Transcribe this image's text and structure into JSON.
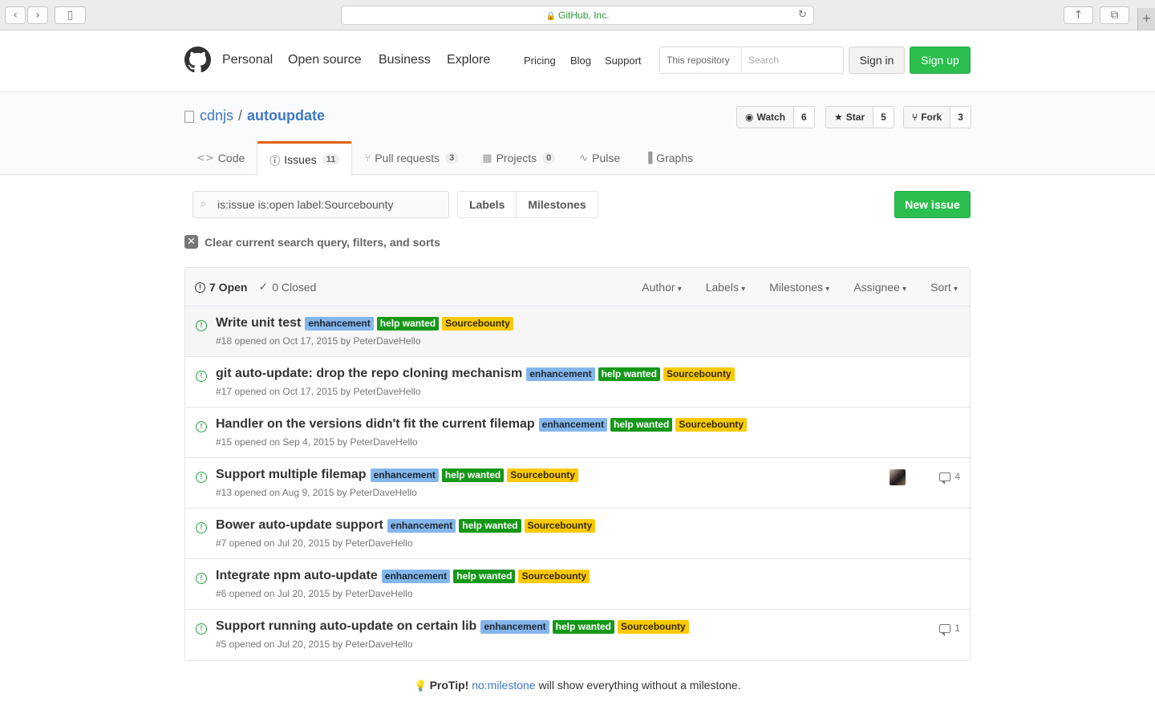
{
  "browser": {
    "url_text": "GitHub, Inc.",
    "back_icon": "chevron-left-icon",
    "forward_icon": "chevron-right-icon"
  },
  "header": {
    "nav_primary": [
      "Personal",
      "Open source",
      "Business",
      "Explore"
    ],
    "nav_secondary": [
      "Pricing",
      "Blog",
      "Support"
    ],
    "search_scope": "This repository",
    "search_placeholder": "Search",
    "signin": "Sign in",
    "signup": "Sign up"
  },
  "repo": {
    "owner": "cdnjs",
    "separator": "/",
    "name": "autoupdate",
    "watch_label": "Watch",
    "watch_count": "6",
    "star_label": "Star",
    "star_count": "5",
    "fork_label": "Fork",
    "fork_count": "3",
    "tabs": [
      {
        "label": "Code",
        "counter": ""
      },
      {
        "label": "Issues",
        "counter": "11"
      },
      {
        "label": "Pull requests",
        "counter": "3"
      },
      {
        "label": "Projects",
        "counter": "0"
      },
      {
        "label": "Pulse",
        "counter": ""
      },
      {
        "label": "Graphs",
        "counter": ""
      }
    ]
  },
  "subnav": {
    "filter_query": "is:issue is:open label:Sourcebounty",
    "labels": "Labels",
    "milestones": "Milestones",
    "new_issue": "New issue",
    "clear": "Clear current search query, filters, and sorts"
  },
  "issues_header": {
    "open": "7 Open",
    "closed": "0 Closed",
    "filters": [
      "Author",
      "Labels",
      "Milestones",
      "Assignee",
      "Sort"
    ]
  },
  "label_names": {
    "enhancement": "enhancement",
    "help": "help wanted",
    "source": "Sourcebounty"
  },
  "colors": {
    "enhancement": "#84b6eb",
    "help_wanted": "#159818",
    "sourcebounty": "#fbca04",
    "open_green": "#28a745",
    "link_blue": "#4078c0"
  },
  "issues": [
    {
      "title": "Write unit test",
      "meta": "#18 opened on Oct 17, 2015 by PeterDaveHello",
      "comments": ""
    },
    {
      "title": "git auto-update: drop the repo cloning mechanism",
      "meta": "#17 opened on Oct 17, 2015 by PeterDaveHello",
      "comments": ""
    },
    {
      "title": "Handler on the versions didn't fit the current filemap",
      "meta": "#15 opened on Sep 4, 2015 by PeterDaveHello",
      "comments": ""
    },
    {
      "title": "Support multiple filemap",
      "meta": "#13 opened on Aug 9, 2015 by PeterDaveHello",
      "comments": "4"
    },
    {
      "title": "Bower auto-update support",
      "meta": "#7 opened on Jul 20, 2015 by PeterDaveHello",
      "comments": ""
    },
    {
      "title": "Integrate npm auto-update",
      "meta": "#6 opened on Jul 20, 2015 by PeterDaveHello",
      "comments": ""
    },
    {
      "title": "Support running auto-update on certain lib",
      "meta": "#5 opened on Jul 20, 2015 by PeterDaveHello",
      "comments": "1"
    }
  ],
  "protip": {
    "lead": "ProTip!",
    "link": "no:milestone",
    "rest": "will show everything without a milestone."
  }
}
